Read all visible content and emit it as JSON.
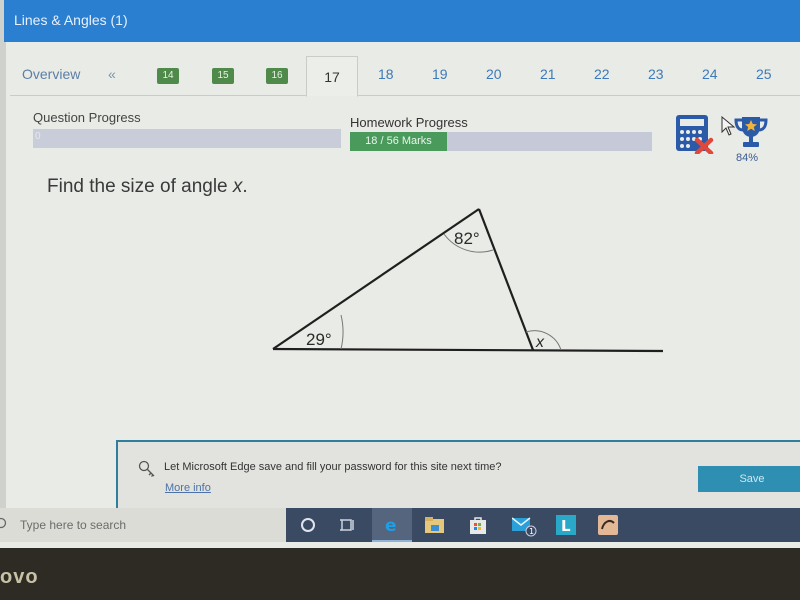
{
  "window": {
    "title": "Lines & Angles (1)"
  },
  "nav": {
    "overview": "Overview",
    "prev": "«",
    "completed": [
      "14",
      "15",
      "16"
    ],
    "current": "17",
    "upcoming": [
      "18",
      "19",
      "20",
      "21",
      "22",
      "23",
      "24",
      "25"
    ]
  },
  "progress": {
    "question_label": "Question Progress",
    "question_value": "0",
    "homework_label": "Homework Progress",
    "homework_text": "18 / 56 Marks",
    "homework_fraction": 0.32
  },
  "tools": {
    "calculator": "calculator-not-allowed-icon",
    "trophy_percent": "84%"
  },
  "question": {
    "prefix": "Find the size of angle ",
    "variable": "x",
    "suffix": "."
  },
  "diagram": {
    "angle_top": "82°",
    "angle_left": "29°",
    "angle_unknown": "x"
  },
  "edge_prompt": {
    "message": "Let Microsoft Edge save and fill your password for this site next time?",
    "more_info": "More info",
    "save": "Save"
  },
  "taskbar": {
    "search_placeholder": "Type here to search",
    "mail_badge": "1",
    "apps": [
      "cortana",
      "task-view",
      "edge",
      "file-explorer",
      "store",
      "mail",
      "l-app",
      "photo-app"
    ]
  },
  "bezel": {
    "brand": "ovo"
  },
  "colors": {
    "title_bar": "#2a7fd0",
    "completed_green": "#4f8a4a",
    "progress_green": "#4a9a5c",
    "progress_track": "#c6cad8",
    "calc_blue": "#2a5aa8",
    "red_x": "#e0483c",
    "edge_save": "#2f8fb3"
  }
}
